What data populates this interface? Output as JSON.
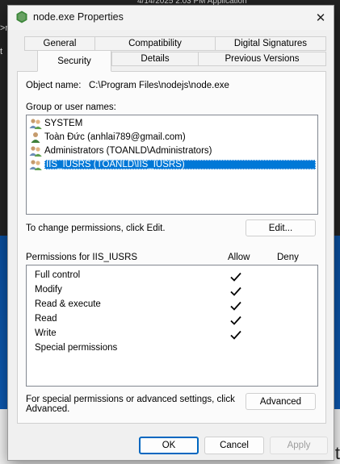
{
  "background": {
    "top_fragment": "4/14/2025 2:03 PM      Application",
    "left_fragments": [
      ">rov",
      "t"
    ],
    "right_fragment": "ci t"
  },
  "dialog": {
    "title": "node.exe Properties",
    "close_glyph": "✕"
  },
  "tabs": {
    "row1": [
      {
        "label": "General"
      },
      {
        "label": "Compatibility"
      },
      {
        "label": "Digital Signatures"
      }
    ],
    "row2": [
      {
        "label": "Security",
        "active": true
      },
      {
        "label": "Details"
      },
      {
        "label": "Previous Versions"
      }
    ]
  },
  "security": {
    "object_name_label": "Object name:",
    "object_name_value": "C:\\Program Files\\nodejs\\node.exe",
    "group_label": "Group or user names:",
    "users": [
      {
        "name": "SYSTEM",
        "icon": "users-group-icon",
        "selected": false
      },
      {
        "name": "Toàn Đức (anhlai789@gmail.com)",
        "icon": "user-icon",
        "selected": false
      },
      {
        "name": "Administrators (TOANLD\\Administrators)",
        "icon": "users-group-icon",
        "selected": false
      },
      {
        "name": "IIS_IUSRS (TOANLD\\IIS_IUSRS)",
        "icon": "users-group-icon",
        "selected": true
      }
    ],
    "change_text": "To change permissions, click Edit.",
    "edit_button": "Edit...",
    "permissions_label": "Permissions for IIS_IUSRS",
    "allow_header": "Allow",
    "deny_header": "Deny",
    "permissions": [
      {
        "name": "Full control",
        "allow": true,
        "deny": false
      },
      {
        "name": "Modify",
        "allow": true,
        "deny": false
      },
      {
        "name": "Read & execute",
        "allow": true,
        "deny": false
      },
      {
        "name": "Read",
        "allow": true,
        "deny": false
      },
      {
        "name": "Write",
        "allow": true,
        "deny": false
      },
      {
        "name": "Special permissions",
        "allow": false,
        "deny": false
      }
    ],
    "special_text_line1": "For special permissions or advanced settings, click",
    "special_text_line2": "Advanced.",
    "advanced_button": "Advanced"
  },
  "footer": {
    "ok": "OK",
    "cancel": "Cancel",
    "apply": "Apply"
  },
  "colors": {
    "selection": "#0078d7",
    "default_button_border": "#0067c0",
    "app_icon": "#3c873a"
  }
}
